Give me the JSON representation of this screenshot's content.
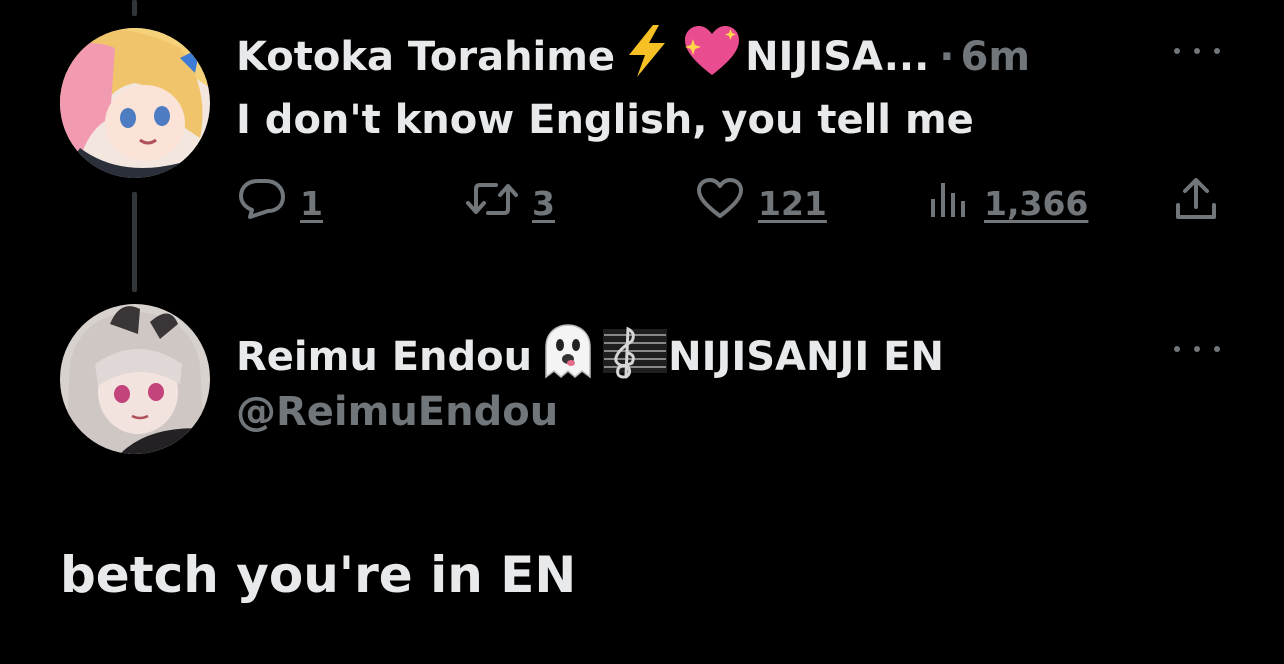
{
  "colors": {
    "background": "#000000",
    "text_primary": "#e7e9ea",
    "text_secondary": "#71767b",
    "thread_line": "#333639"
  },
  "parent_tweet": {
    "display_name": "Kotoka Torahime",
    "name_emojis": [
      "lightning-emoji",
      "sparkling-heart-emoji"
    ],
    "name_suffix": "NIJISA...",
    "separator": "·",
    "timestamp": "6m",
    "text": "I don't know English, you tell me",
    "actions": {
      "replies": "1",
      "retweets": "3",
      "likes": "121",
      "views": "1,366"
    },
    "icons": {
      "reply": "reply-icon",
      "retweet": "retweet-icon",
      "like": "heart-icon",
      "views": "views-icon",
      "share": "share-icon",
      "more": "more-icon"
    }
  },
  "reply_tweet": {
    "display_name": "Reimu Endou",
    "name_emojis": [
      "ghost-emoji",
      "musical-score-emoji"
    ],
    "name_suffix": "NIJISANJI EN",
    "handle": "@ReimuEndou",
    "text": "betch you're in EN"
  }
}
